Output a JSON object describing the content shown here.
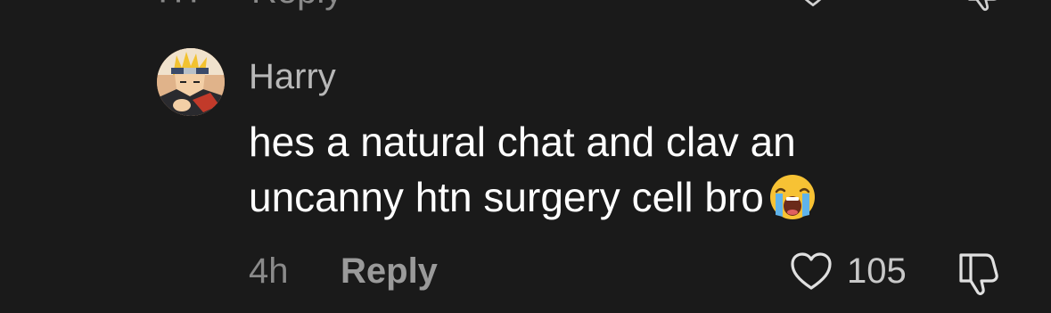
{
  "previous_comment": {
    "reply_label": "Reply",
    "like_count": "",
    "like_icon": "heart-icon",
    "dislike_icon": "thumbs-down-icon"
  },
  "comment": {
    "username": "Harry",
    "avatar_icon": "avatar-anime-character",
    "text_line1": "hes a natural chat and clav an",
    "text_line2": "uncanny htn surgery cell bro",
    "emoji": "loudly-crying-face-emoji",
    "timestamp": "4h",
    "reply_label": "Reply",
    "like_icon": "heart-icon",
    "like_count": "105",
    "dislike_icon": "thumbs-down-icon"
  },
  "colors": {
    "background": "#1a1a1a",
    "text_primary": "#ffffff",
    "text_secondary": "#8a8a8a"
  }
}
